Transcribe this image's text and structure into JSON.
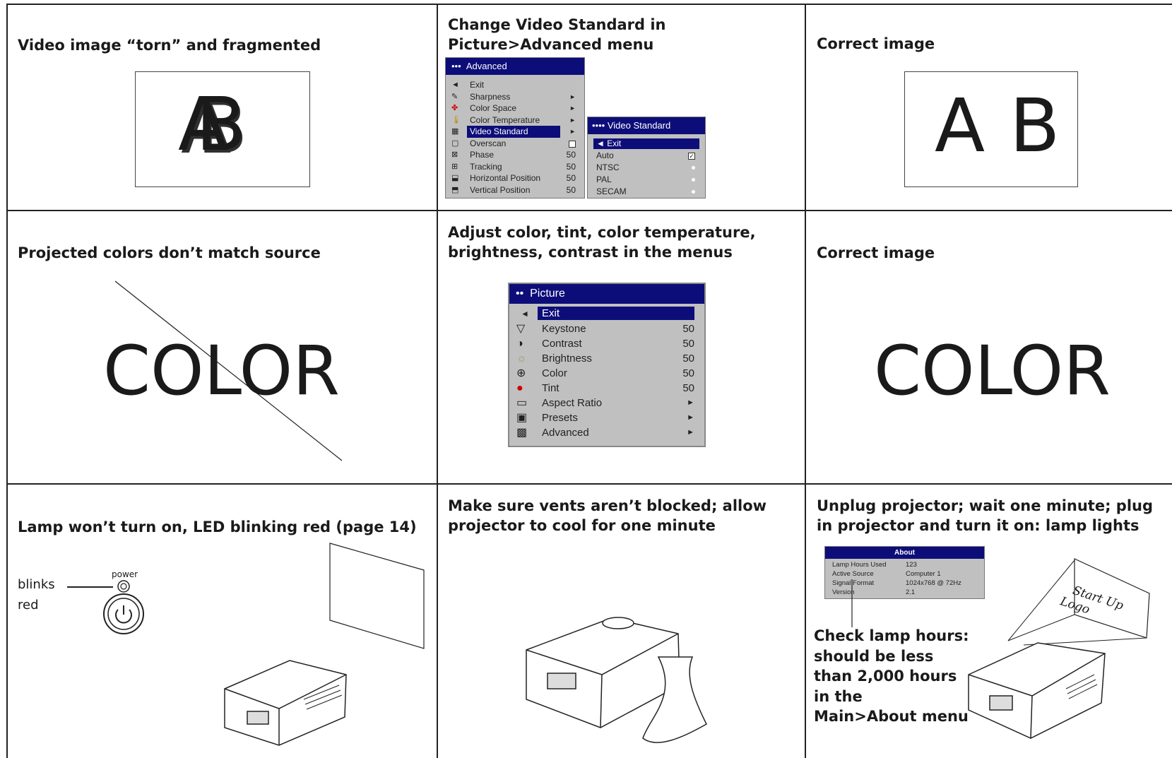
{
  "rows": [
    {
      "problem": "Video image “torn” and fragmented",
      "solution": "Change Video Standard in Picture>Advanced menu",
      "result": "Correct image",
      "problem_letters": "AB",
      "result_letters": [
        "A",
        "B"
      ]
    },
    {
      "problem": "Projected colors don’t match source",
      "solution": "Adjust color, tint, color temperature, brightness, contrast in the menus",
      "result": "Correct image",
      "problem_word": "COLOR",
      "result_word": "COLOR"
    },
    {
      "problem": "Lamp won’t turn on, LED blinking red (page 14)",
      "solution": "Make sure vents aren’t blocked; allow projector to cool for one minute",
      "result": "Unplug projector; wait one minute; plug in projector and turn it on: lamp lights"
    }
  ],
  "advanced_menu": {
    "title": "Advanced",
    "dots": "•••",
    "items": [
      {
        "label": "Exit",
        "value": "",
        "icon": "back-arrow-icon"
      },
      {
        "label": "Sharpness",
        "value": "►",
        "icon": "sharpness-icon"
      },
      {
        "label": "Color Space",
        "value": "►",
        "icon": "color-space-icon"
      },
      {
        "label": "Color Temperature",
        "value": "►",
        "icon": "thermometer-icon"
      },
      {
        "label": "Video Standard",
        "value": "►",
        "icon": "video-standard-icon"
      },
      {
        "label": "Overscan",
        "value": "",
        "icon": "overscan-icon"
      },
      {
        "label": "Phase",
        "value": "50",
        "icon": "phase-icon"
      },
      {
        "label": "Tracking",
        "value": "50",
        "icon": "tracking-icon"
      },
      {
        "label": "Horizontal Position",
        "value": "50",
        "icon": "horizontal-position-icon"
      },
      {
        "label": "Vertical Position",
        "value": "50",
        "icon": "vertical-position-icon"
      }
    ],
    "selected": 4
  },
  "video_standard_menu": {
    "title": "Video Standard",
    "dots": "••••",
    "exit": "◄ Exit",
    "options": [
      {
        "label": "Auto",
        "checked": true
      },
      {
        "label": "NTSC",
        "checked": false
      },
      {
        "label": "PAL",
        "checked": false
      },
      {
        "label": "SECAM",
        "checked": false
      }
    ]
  },
  "picture_menu": {
    "title": "Picture",
    "dots": "••",
    "items": [
      {
        "label": "Exit",
        "value": "",
        "icon": "back-arrow-icon"
      },
      {
        "label": "Keystone",
        "value": "50",
        "icon": "keystone-icon"
      },
      {
        "label": "Contrast",
        "value": "50",
        "icon": "contrast-icon"
      },
      {
        "label": "Brightness",
        "value": "50",
        "icon": "brightness-icon"
      },
      {
        "label": "Color",
        "value": "50",
        "icon": "color-icon"
      },
      {
        "label": "Tint",
        "value": "50",
        "icon": "tint-icon"
      },
      {
        "label": "Aspect Ratio",
        "value": "►",
        "icon": "aspect-ratio-icon"
      },
      {
        "label": "Presets",
        "value": "►",
        "icon": "presets-icon"
      },
      {
        "label": "Advanced",
        "value": "►",
        "icon": "advanced-icon"
      }
    ]
  },
  "lamp_panel": {
    "power_label": "power",
    "blinks_label": "blinks",
    "red_label": "red"
  },
  "about_menu": {
    "title": "About",
    "rows": [
      {
        "label": "Lamp Hours Used",
        "value": "123"
      },
      {
        "label": "Active Source",
        "value": "Computer 1"
      },
      {
        "label": "Signal Format",
        "value": "1024x768 @ 72Hz"
      },
      {
        "label": "Version",
        "value": "2.1"
      }
    ],
    "note": "Check lamp hours: should be less than 2,000 hours in the Main>About menu",
    "note_lines": [
      "Check lamp hours:",
      "should be less",
      "than 2,000 hours",
      "in the",
      "Main>About menu"
    ]
  },
  "startup_logo": {
    "line1": "Start Up",
    "line2": "Logo"
  },
  "colors": {
    "menu_bar": "#0d0d7a",
    "menu_bg": "#c0c0c0",
    "text": "#1a1a1a"
  }
}
